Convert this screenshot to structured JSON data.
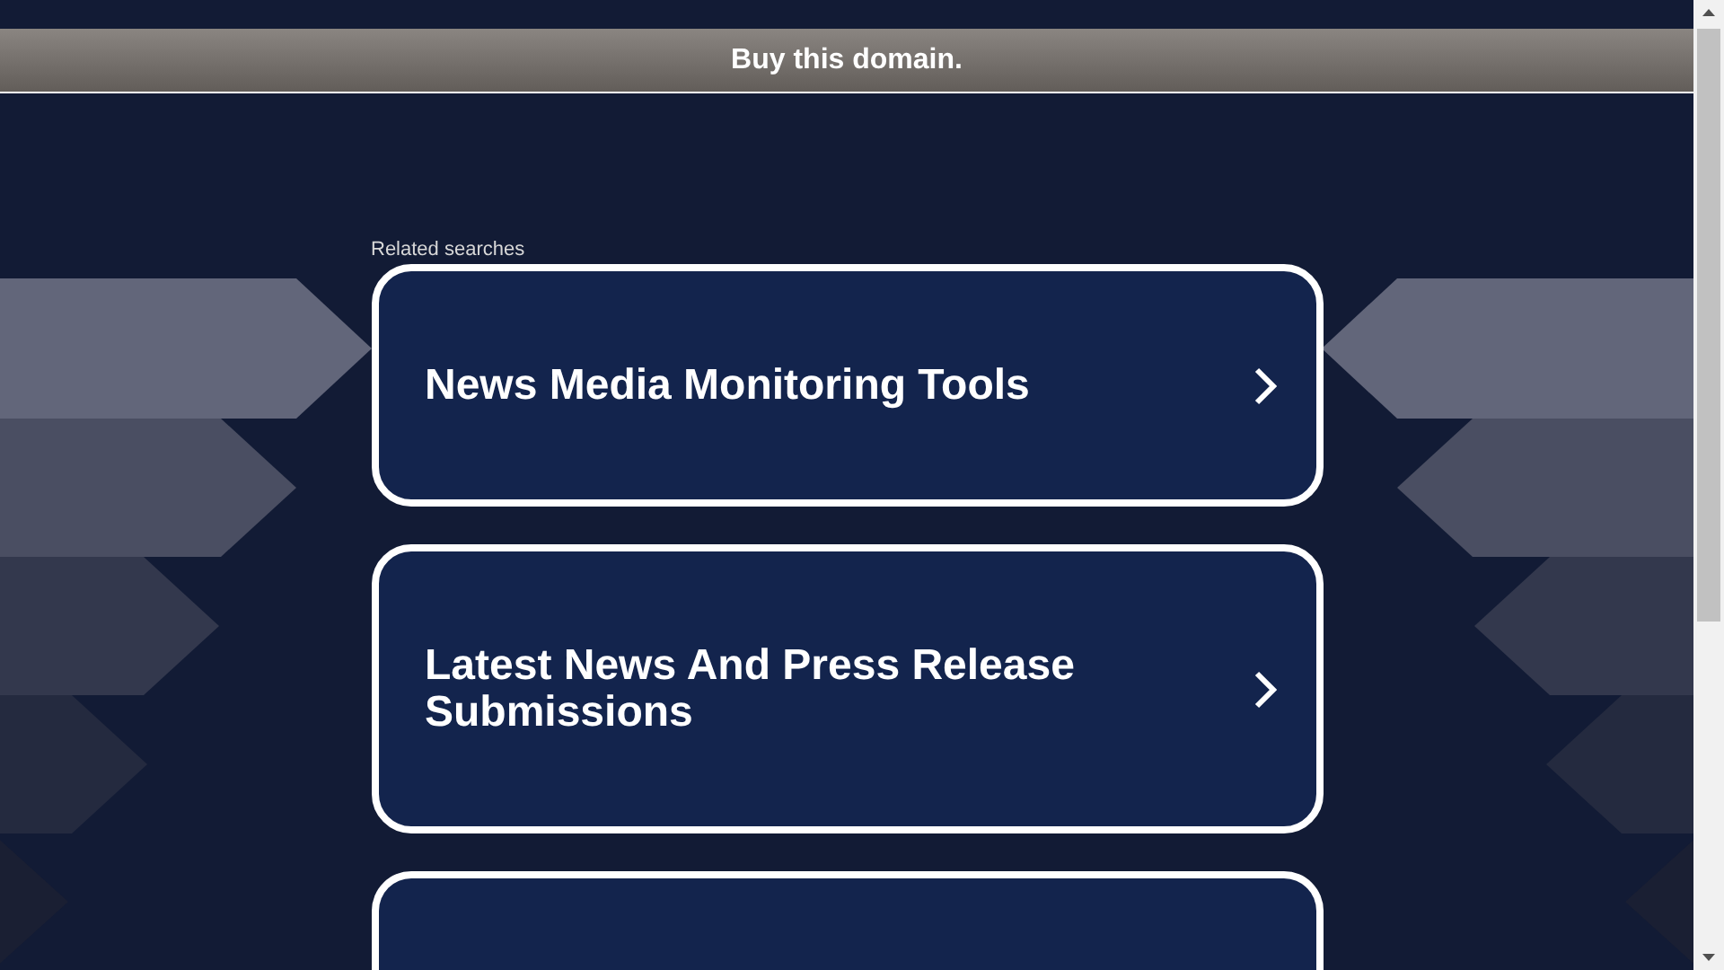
{
  "banner": {
    "text": "Buy this domain."
  },
  "related": {
    "heading": "Related searches",
    "cards": [
      {
        "title": "News Media Monitoring Tools",
        "cut_off": false
      },
      {
        "title": "Latest News And Press Release Submissions",
        "cut_off": false
      },
      {
        "cut_off": true
      }
    ]
  }
}
